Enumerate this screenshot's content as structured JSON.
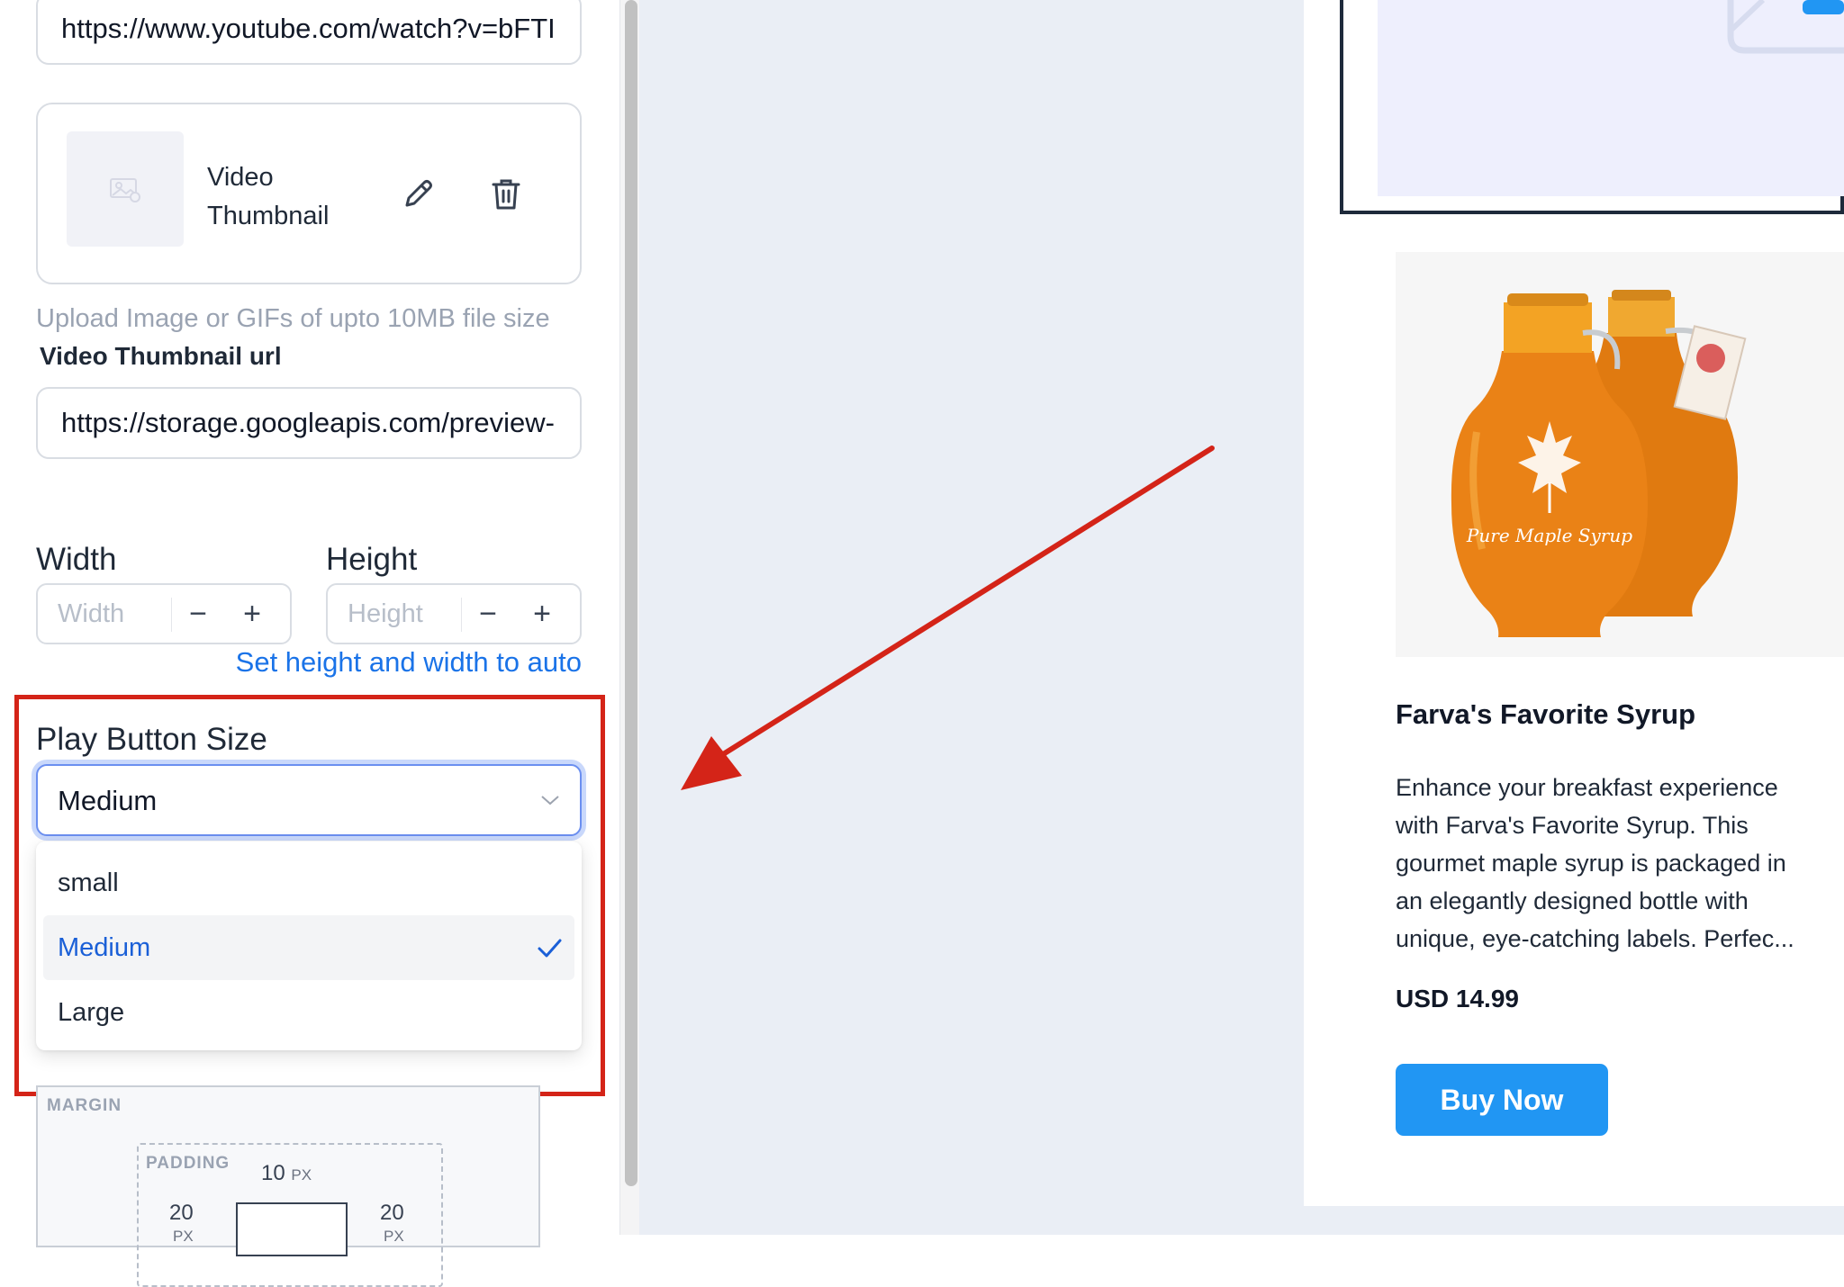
{
  "video_url": {
    "value": "https://www.youtube.com/watch?v=bFTI"
  },
  "thumbnail_card": {
    "title": "Video Thumbnail",
    "edit_icon": "pencil-icon",
    "delete_icon": "trash-icon",
    "placeholder_icon": "image-icon"
  },
  "upload_help": "Upload Image or GIFs of upto 10MB file size",
  "thumbnail_url": {
    "label": "Video Thumbnail url",
    "value": "https://storage.googleapis.com/preview-"
  },
  "width": {
    "label": "Width",
    "placeholder": "Width",
    "minus": "−",
    "plus": "+"
  },
  "height": {
    "label": "Height",
    "placeholder": "Height",
    "minus": "−",
    "plus": "+"
  },
  "auto_link": "Set height and width to auto",
  "play_button_size": {
    "label": "Play Button Size",
    "selected": "Medium",
    "options": [
      {
        "label": "small",
        "selected": false
      },
      {
        "label": "Medium",
        "selected": true
      },
      {
        "label": "Large",
        "selected": false
      }
    ]
  },
  "spacing": {
    "margin_label": "MARGIN",
    "padding_label": "PADDING",
    "padding_top": "10",
    "padding_left": "20",
    "padding_right": "20",
    "unit": "PX"
  },
  "product": {
    "title": "Farva's Favorite Syrup",
    "description": "Enhance your breakfast experience with Farva's Favorite Syrup. This gourmet maple syrup is packaged in an elegantly designed bottle with unique, eye-catching labels. Perfec...",
    "price": "USD 14.99",
    "button": "Buy Now",
    "image_text": "Pure Maple Syrup"
  },
  "colors": {
    "accent": "#1a73e8",
    "buy_button": "#2196f3",
    "highlight": "#d42418",
    "canvas": "#eaeef5"
  }
}
